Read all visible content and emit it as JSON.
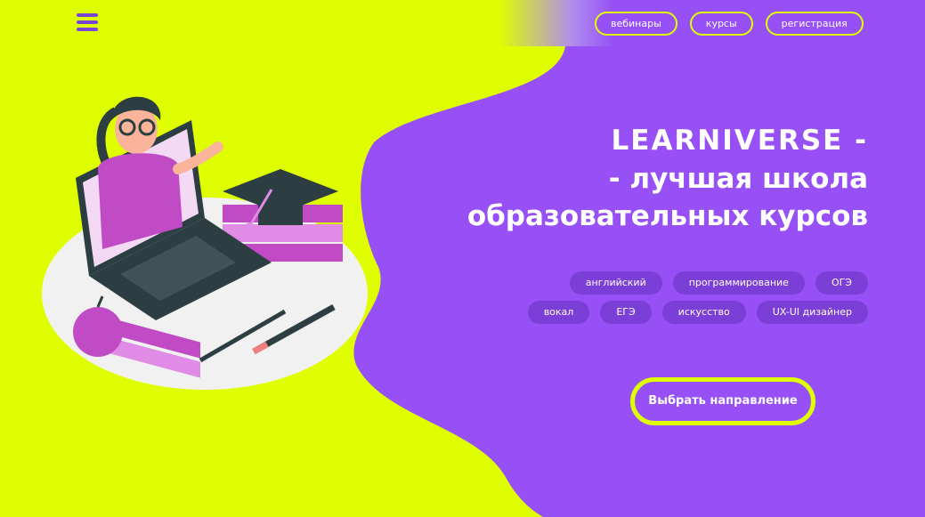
{
  "header": {
    "menu_icon": "hamburger-menu-icon",
    "nav": [
      "вебинары",
      "курсы",
      "регистрация"
    ]
  },
  "hero": {
    "logo": "LEARNIVERSE -",
    "title_line1": "- лучшая школа",
    "title_line2": "образовательных курсов"
  },
  "tags": {
    "row1": [
      "английский",
      "программирование",
      "ОГЭ"
    ],
    "row2": [
      "вокал",
      "ЕГЭ",
      "искусство",
      "UX-UI дизайнер"
    ]
  },
  "cta": {
    "label": "Выбрать направление"
  },
  "colors": {
    "lime": "#dfff00",
    "purple": "#9650f5",
    "tag": "#7b3ed6"
  },
  "illustration": {
    "icon": "teacher-with-laptop-books-graduation-cap-illustration"
  }
}
